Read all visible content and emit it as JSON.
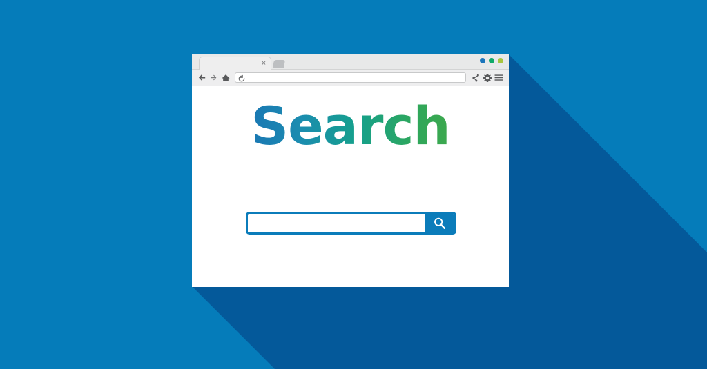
{
  "scene": {
    "background_color": "#057cba",
    "shadow_color": "#04599a",
    "shadow_direction": "45deg-down-right"
  },
  "browser": {
    "window_background": "#ffffff",
    "chrome_background": "#eeeeef",
    "tab": {
      "title": "",
      "close_label": "×",
      "close_icon_name": "close-icon",
      "new_tab_icon_name": "new-tab-icon"
    },
    "window_dots": [
      {
        "name": "window-dot-blue",
        "color": "#1b75bb"
      },
      {
        "name": "window-dot-green",
        "color": "#0faa68"
      },
      {
        "name": "window-dot-yellow",
        "color": "#a8c63e"
      }
    ],
    "toolbar": {
      "back_icon": "back-arrow-icon",
      "forward_icon": "forward-arrow-icon",
      "home_icon": "home-icon",
      "reload_icon": "reload-icon",
      "share_icon": "share-icon",
      "settings_icon": "gear-icon",
      "menu_icon": "hamburger-menu-icon",
      "icon_color": "#58595b"
    },
    "address_bar": {
      "value": "",
      "placeholder": ""
    }
  },
  "page": {
    "title": "Search",
    "title_gradient_start": "#1a6fb5",
    "title_gradient_mid": "#15a08c",
    "title_gradient_end": "#46a845",
    "search": {
      "input_value": "",
      "input_placeholder": "",
      "button_label": "",
      "button_icon": "magnifier-icon",
      "accent_color": "#0b7cba"
    }
  }
}
